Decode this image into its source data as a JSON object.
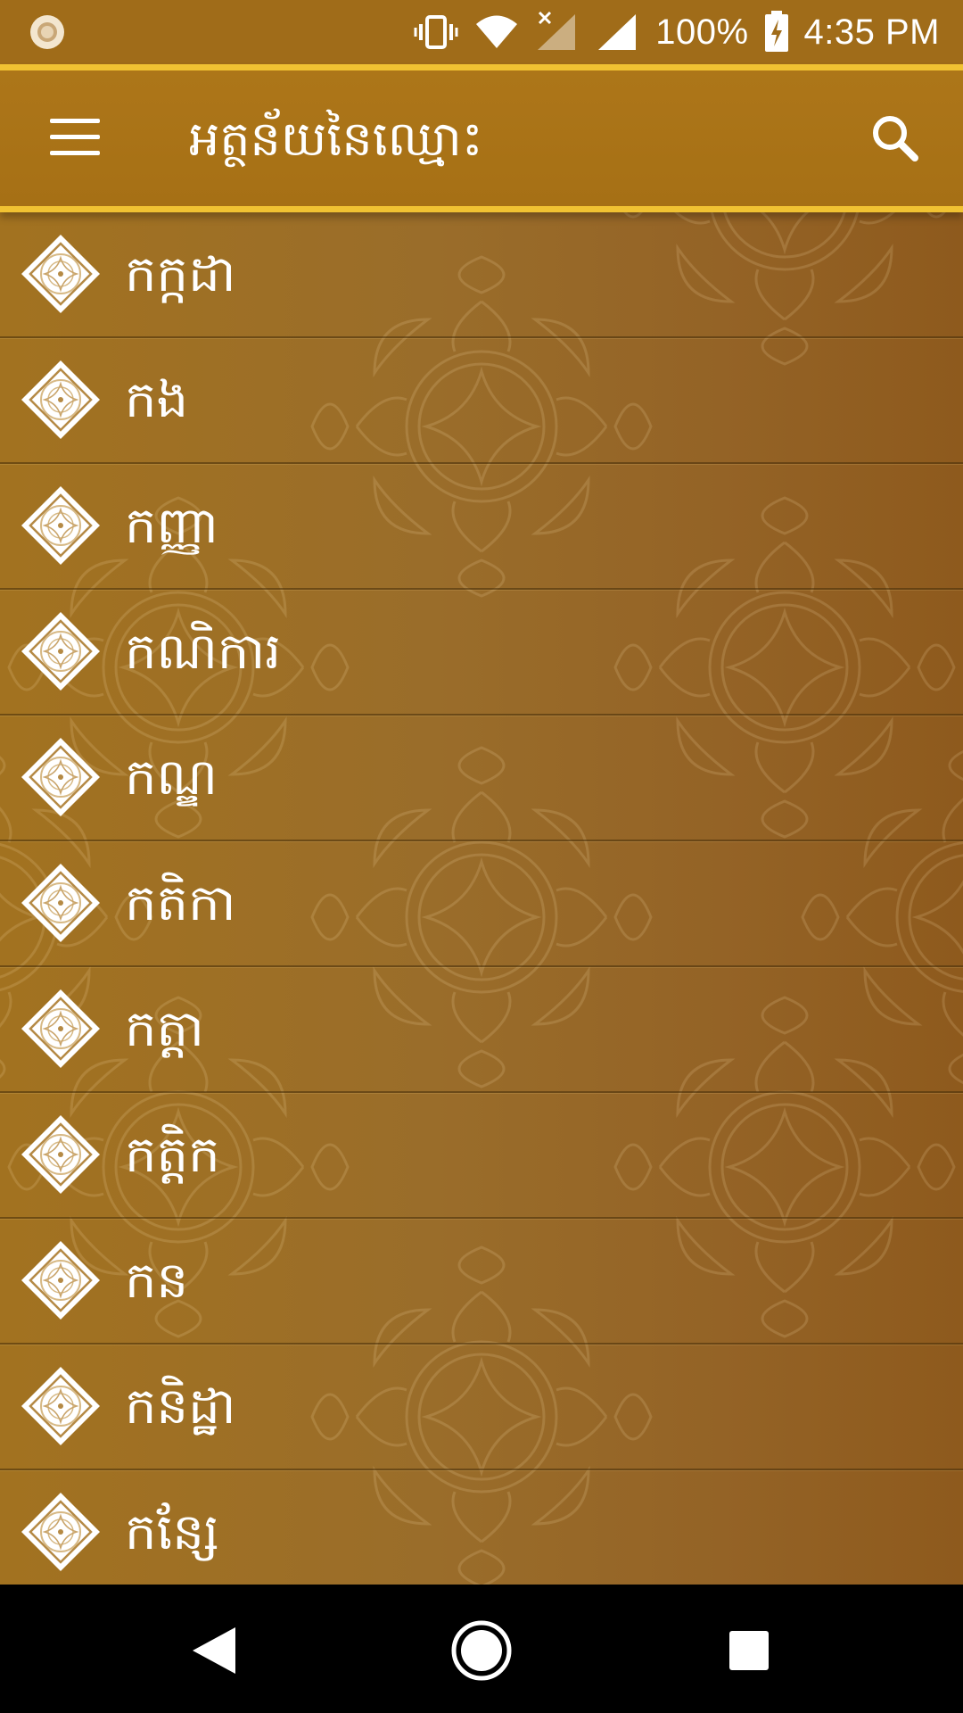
{
  "status_bar": {
    "battery_text": "100%",
    "time": "4:35 PM",
    "icons": [
      "notification-icon",
      "vibrate-icon",
      "wifi-icon",
      "signal-no-data-icon",
      "signal-icon",
      "battery-charging-icon"
    ]
  },
  "app_bar": {
    "title": "អត្ថន័យនៃឈ្មោះ",
    "menu_icon": "hamburger-menu-icon",
    "search_icon": "search-icon"
  },
  "list": {
    "items": [
      {
        "label": "កក្កដា"
      },
      {
        "label": "កង"
      },
      {
        "label": "កញ្ញា"
      },
      {
        "label": "កណិការ"
      },
      {
        "label": "កណ្ឌ"
      },
      {
        "label": "កតិកា"
      },
      {
        "label": "កត្តា"
      },
      {
        "label": "កត្តិក"
      },
      {
        "label": "កន"
      },
      {
        "label": "កនិដ្ឋា"
      },
      {
        "label": "កន្សែ"
      }
    ],
    "item_icon": "diamond-ornament-icon"
  },
  "nav_bar": {
    "icons": [
      "back-icon",
      "home-icon",
      "recents-icon"
    ]
  },
  "colors": {
    "status_bar": "#a06c19",
    "app_bar": "#ad7619",
    "accent_stripe": "#f1c232",
    "list_background": "#9a6d2a",
    "text": "#ffffff"
  }
}
